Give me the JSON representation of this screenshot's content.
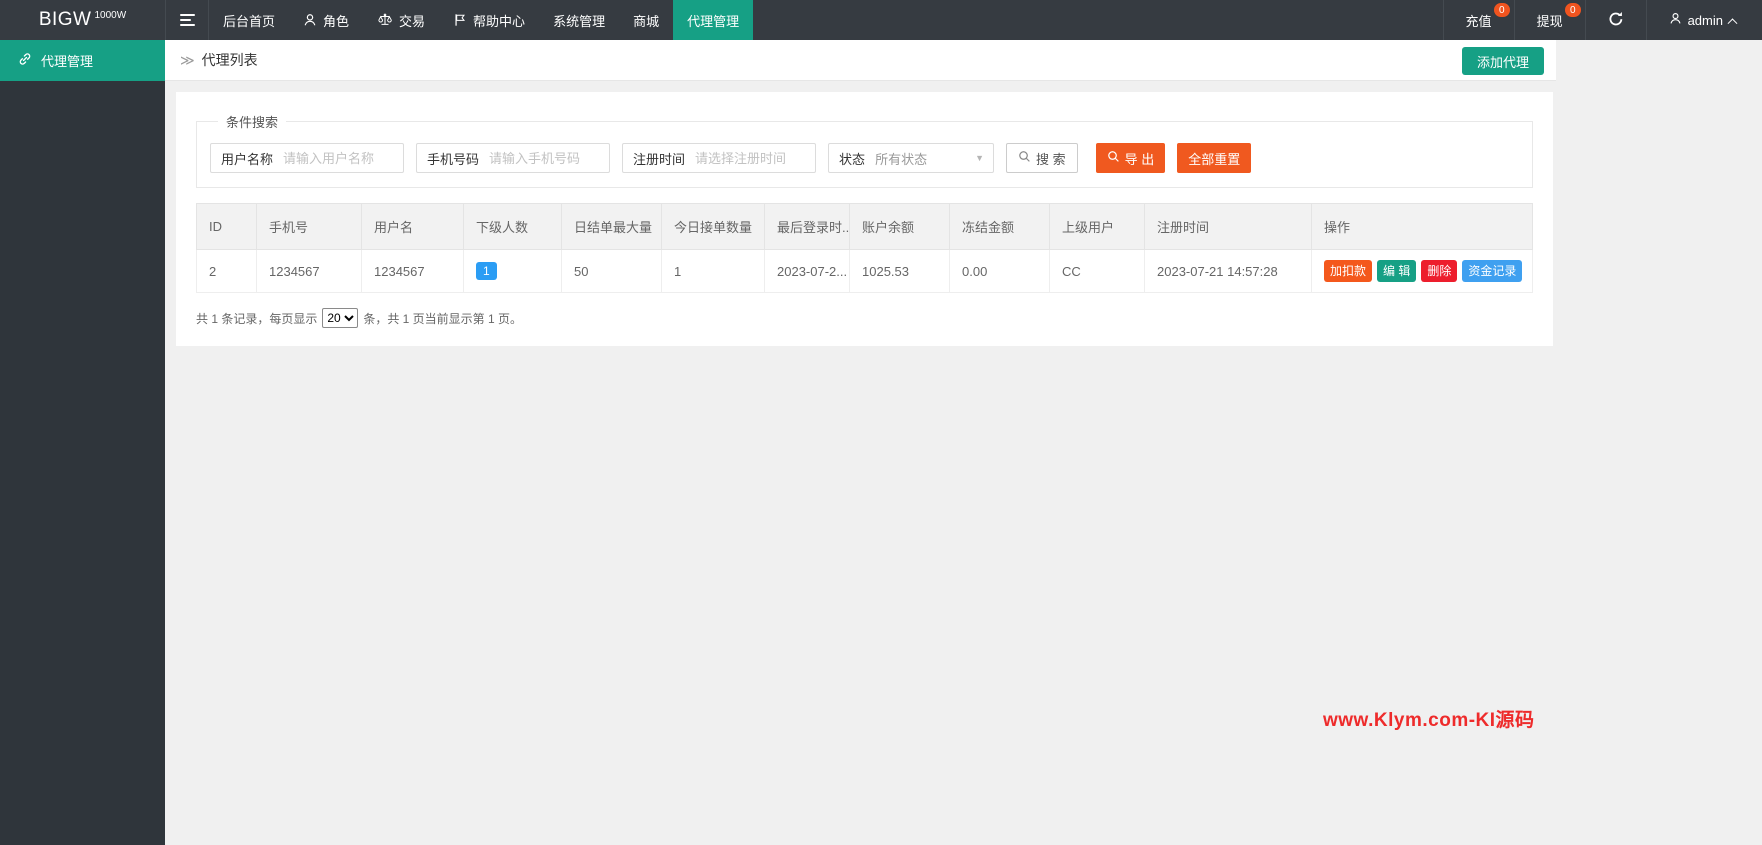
{
  "navbar": {
    "logo_text": "BIGW",
    "logo_sup": "1000W",
    "items": [
      {
        "label": "后台首页"
      },
      {
        "label": "角色",
        "icon": "user-icon"
      },
      {
        "label": "交易",
        "icon": "scales-icon"
      },
      {
        "label": "帮助中心",
        "icon": "flag-icon"
      },
      {
        "label": "系统管理"
      },
      {
        "label": "商城"
      },
      {
        "label": "代理管理",
        "active": true
      }
    ],
    "recharge": {
      "label": "充值",
      "badge": "0"
    },
    "withdraw": {
      "label": "提现",
      "badge": "0"
    },
    "user": {
      "name": "admin"
    }
  },
  "sidebar": {
    "items": [
      {
        "label": "代理管理",
        "icon": "link-icon",
        "active": true
      }
    ]
  },
  "breadcrumb": {
    "title": "代理列表",
    "add_button": "添加代理"
  },
  "search": {
    "legend": "条件搜索",
    "fields": [
      {
        "label": "用户名称",
        "placeholder": "请输入用户名称"
      },
      {
        "label": "手机号码",
        "placeholder": "请输入手机号码"
      },
      {
        "label": "注册时间",
        "placeholder": "请选择注册时间"
      },
      {
        "label": "状态",
        "value": "所有状态"
      }
    ],
    "buttons": {
      "search": "搜 索",
      "export": "导 出",
      "reset": "全部重置"
    }
  },
  "table": {
    "headers": [
      "ID",
      "手机号",
      "用户名",
      "下级人数",
      "日结单最大量",
      "今日接单数量",
      "最后登录时...",
      "账户余额",
      "冻结金额",
      "上级用户",
      "注册时间",
      "操作"
    ],
    "rows": [
      {
        "id": "2",
        "phone": "1234567",
        "username": "1234567",
        "subordinates": "1",
        "daily_max": "50",
        "today_orders": "1",
        "last_login": "2023-07-2...",
        "balance": "1025.53",
        "frozen": "0.00",
        "parent_user": "CC",
        "reg_time": "2023-07-21 14:57:28"
      }
    ],
    "actions": [
      "加扣款",
      "编 辑",
      "删除",
      "资金记录"
    ]
  },
  "pagination": {
    "prefix": "共 1 条记录，每页显示",
    "page_size": "20",
    "suffix": "条，共 1 页当前显示第 1 页。"
  },
  "watermark": "www.Klym.com-KI源码",
  "colors": {
    "accent_teal": "#16a085",
    "orange": "#f0591f",
    "action_orange": "#f4581c",
    "action_red": "#ed1e2d",
    "action_blue": "#3fa0f0",
    "badge_blue": "#2b9df4",
    "badge_orange": "#f0541f",
    "navbar_bg": "#363b41",
    "sidebar_bg": "#2f353b",
    "watermark_red": "#ee2b2b"
  },
  "icons": {
    "menu-icon": "three horizontal bars",
    "user-icon": "person silhouette",
    "scales-icon": "balance scales",
    "flag-icon": "flag on pole",
    "refresh-icon": "circular arrow",
    "chevron-up-icon": "chevron up ∧",
    "link-icon": "chain link",
    "double-chevron-icon": "≫",
    "search-icon": "magnifier",
    "caret-down-icon": "▼"
  }
}
